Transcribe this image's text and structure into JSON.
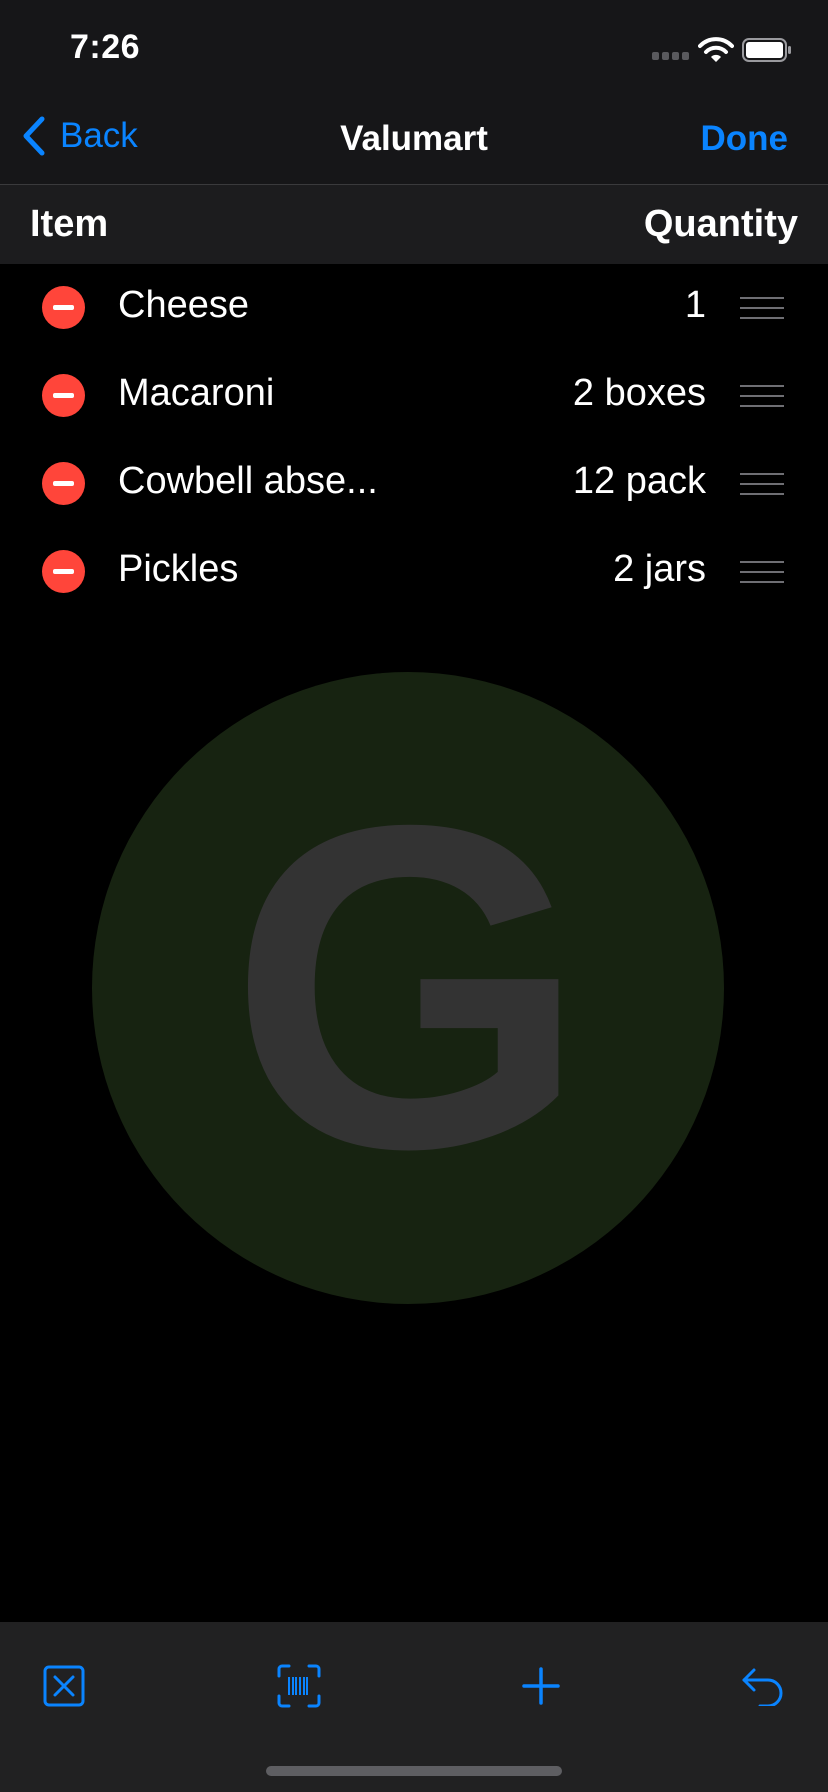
{
  "status_bar": {
    "time": "7:26",
    "icons": [
      "cellular-signal-icon",
      "wifi-icon",
      "battery-icon"
    ]
  },
  "nav": {
    "back_label": "Back",
    "title": "Valumart",
    "done_label": "Done"
  },
  "columns": {
    "item": "Item",
    "quantity": "Quantity"
  },
  "items": [
    {
      "name": "Cheese",
      "quantity": "1"
    },
    {
      "name": "Macaroni",
      "quantity": "2 boxes"
    },
    {
      "name": "Cowbell abse...",
      "quantity": "12 pack"
    },
    {
      "name": "Pickles",
      "quantity": "2 jars"
    }
  ],
  "watermark": {
    "letter": "G"
  },
  "toolbar": {
    "icons": [
      "clear-list-icon",
      "barcode-scan-icon",
      "add-icon",
      "undo-icon"
    ]
  },
  "colors": {
    "accent": "#0a84ff",
    "delete": "#ff453a",
    "background": "#000000",
    "bars": "#161618",
    "watermark_circle": "#172311",
    "watermark_letter": "#333333"
  }
}
